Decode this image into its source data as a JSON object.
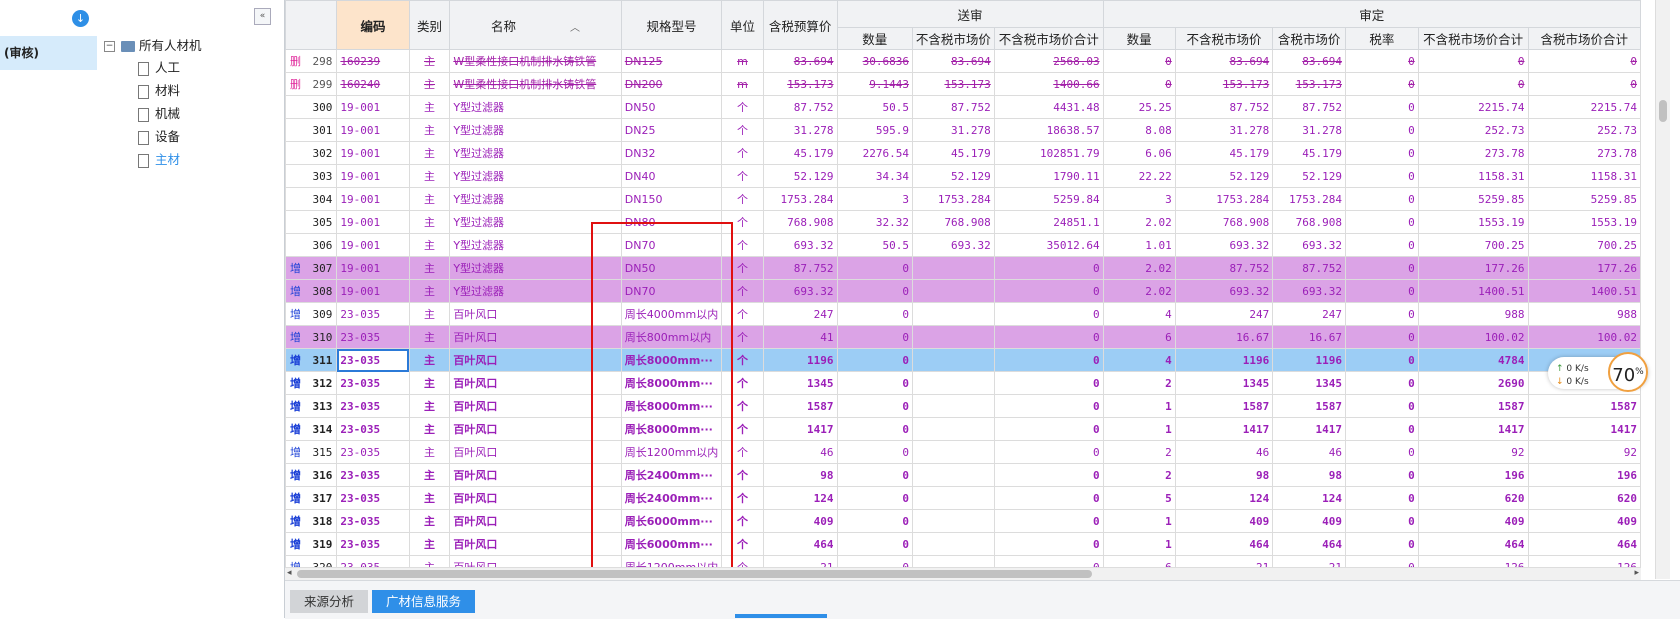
{
  "left_nav": {
    "audit_label": "(审核)"
  },
  "tree": {
    "root": "所有人材机",
    "children": [
      {
        "label": "人工",
        "active": false
      },
      {
        "label": "材料",
        "active": false
      },
      {
        "label": "机械",
        "active": false
      },
      {
        "label": "设备",
        "active": false
      },
      {
        "label": "主材",
        "active": true
      }
    ],
    "collapse_glyph": "«",
    "toggle_glyph": "−"
  },
  "grid": {
    "headers": {
      "code": "编码",
      "cat": "类别",
      "name": "名称",
      "spec": "规格型号",
      "unit": "单位",
      "budget": "含税预算价",
      "group_send": "送审",
      "group_audit": "审定",
      "s_qty": "数量",
      "s_price": "不含税市场价",
      "s_total": "不含税市场价合计",
      "a_qty": "数量",
      "a_price": "不含税市场价",
      "a_price_tax": "含税市场价",
      "a_rate": "税率",
      "a_total": "不含税市场价合计",
      "a_total_tax": "含税市场价合计"
    },
    "rows": [
      {
        "flag": "删",
        "n": "298",
        "code": "160239",
        "cat": "主",
        "name": "W型柔性接口机制排水铸铁管",
        "spec": "DN125",
        "unit": "m",
        "budget": "83.694",
        "sq": "30.6836",
        "sp": "83.694",
        "st": "2568.03",
        "aq": "0",
        "ap": "83.694",
        "apt": "83.694",
        "ar": "0",
        "at": "0",
        "att": "0",
        "style": "del"
      },
      {
        "flag": "删",
        "n": "299",
        "code": "160240",
        "cat": "主",
        "name": "W型柔性接口机制排水铸铁管",
        "spec": "DN200",
        "unit": "m",
        "budget": "153.173",
        "sq": "9.1443",
        "sp": "153.173",
        "st": "1400.66",
        "aq": "0",
        "ap": "153.173",
        "apt": "153.173",
        "ar": "0",
        "at": "0",
        "att": "0",
        "style": "del"
      },
      {
        "flag": "",
        "n": "300",
        "code": "19-001",
        "cat": "主",
        "name": "Y型过滤器",
        "spec": "DN50",
        "unit": "个",
        "budget": "87.752",
        "sq": "50.5",
        "sp": "87.752",
        "st": "4431.48",
        "aq": "25.25",
        "ap": "87.752",
        "apt": "87.752",
        "ar": "0",
        "at": "2215.74",
        "att": "2215.74",
        "style": ""
      },
      {
        "flag": "",
        "n": "301",
        "code": "19-001",
        "cat": "主",
        "name": "Y型过滤器",
        "spec": "DN25",
        "unit": "个",
        "budget": "31.278",
        "sq": "595.9",
        "sp": "31.278",
        "st": "18638.57",
        "aq": "8.08",
        "ap": "31.278",
        "apt": "31.278",
        "ar": "0",
        "at": "252.73",
        "att": "252.73",
        "style": ""
      },
      {
        "flag": "",
        "n": "302",
        "code": "19-001",
        "cat": "主",
        "name": "Y型过滤器",
        "spec": "DN32",
        "unit": "个",
        "budget": "45.179",
        "sq": "2276.54",
        "sp": "45.179",
        "st": "102851.79",
        "aq": "6.06",
        "ap": "45.179",
        "apt": "45.179",
        "ar": "0",
        "at": "273.78",
        "att": "273.78",
        "style": ""
      },
      {
        "flag": "",
        "n": "303",
        "code": "19-001",
        "cat": "主",
        "name": "Y型过滤器",
        "spec": "DN40",
        "unit": "个",
        "budget": "52.129",
        "sq": "34.34",
        "sp": "52.129",
        "st": "1790.11",
        "aq": "22.22",
        "ap": "52.129",
        "apt": "52.129",
        "ar": "0",
        "at": "1158.31",
        "att": "1158.31",
        "style": ""
      },
      {
        "flag": "",
        "n": "304",
        "code": "19-001",
        "cat": "主",
        "name": "Y型过滤器",
        "spec": "DN150",
        "unit": "个",
        "budget": "1753.284",
        "sq": "3",
        "sp": "1753.284",
        "st": "5259.84",
        "aq": "3",
        "ap": "1753.284",
        "apt": "1753.284",
        "ar": "0",
        "at": "5259.85",
        "att": "5259.85",
        "style": ""
      },
      {
        "flag": "",
        "n": "305",
        "code": "19-001",
        "cat": "主",
        "name": "Y型过滤器",
        "spec": "DN80",
        "unit": "个",
        "budget": "768.908",
        "sq": "32.32",
        "sp": "768.908",
        "st": "24851.1",
        "aq": "2.02",
        "ap": "768.908",
        "apt": "768.908",
        "ar": "0",
        "at": "1553.19",
        "att": "1553.19",
        "style": ""
      },
      {
        "flag": "",
        "n": "306",
        "code": "19-001",
        "cat": "主",
        "name": "Y型过滤器",
        "spec": "DN70",
        "unit": "个",
        "budget": "693.32",
        "sq": "50.5",
        "sp": "693.32",
        "st": "35012.64",
        "aq": "1.01",
        "ap": "693.32",
        "apt": "693.32",
        "ar": "0",
        "at": "700.25",
        "att": "700.25",
        "style": ""
      },
      {
        "flag": "增",
        "n": "307",
        "code": "19-001",
        "cat": "主",
        "name": "Y型过滤器",
        "spec": "DN50",
        "unit": "个",
        "budget": "87.752",
        "sq": "0",
        "sp": "",
        "st": "0",
        "aq": "2.02",
        "ap": "87.752",
        "apt": "87.752",
        "ar": "0",
        "at": "177.26",
        "att": "177.26",
        "style": "add hl"
      },
      {
        "flag": "增",
        "n": "308",
        "code": "19-001",
        "cat": "主",
        "name": "Y型过滤器",
        "spec": "DN70",
        "unit": "个",
        "budget": "693.32",
        "sq": "0",
        "sp": "",
        "st": "0",
        "aq": "2.02",
        "ap": "693.32",
        "apt": "693.32",
        "ar": "0",
        "at": "1400.51",
        "att": "1400.51",
        "style": "add hl"
      },
      {
        "flag": "增",
        "n": "309",
        "code": "23-035",
        "cat": "主",
        "name": "百叶风口",
        "spec": "周长4000mm以内",
        "unit": "个",
        "budget": "247",
        "sq": "0",
        "sp": "",
        "st": "0",
        "aq": "4",
        "ap": "247",
        "apt": "247",
        "ar": "0",
        "at": "988",
        "att": "988",
        "style": "add"
      },
      {
        "flag": "增",
        "n": "310",
        "code": "23-035",
        "cat": "主",
        "name": "百叶风口",
        "spec": "周长800mm以内",
        "unit": "个",
        "budget": "41",
        "sq": "0",
        "sp": "",
        "st": "0",
        "aq": "6",
        "ap": "16.67",
        "apt": "16.67",
        "ar": "0",
        "at": "100.02",
        "att": "100.02",
        "style": "add hl"
      },
      {
        "flag": "增",
        "n": "311",
        "code": "23-035",
        "cat": "主",
        "name": "百叶风口",
        "spec": "周长8000mm···",
        "unit": "个",
        "budget": "1196",
        "sq": "0",
        "sp": "",
        "st": "0",
        "aq": "4",
        "ap": "1196",
        "apt": "1196",
        "ar": "0",
        "at": "4784",
        "att": "",
        "style": "add sel bold"
      },
      {
        "flag": "增",
        "n": "312",
        "code": "23-035",
        "cat": "主",
        "name": "百叶风口",
        "spec": "周长8000mm···",
        "unit": "个",
        "budget": "1345",
        "sq": "0",
        "sp": "",
        "st": "0",
        "aq": "2",
        "ap": "1345",
        "apt": "1345",
        "ar": "0",
        "at": "2690",
        "att": "",
        "style": "add bold"
      },
      {
        "flag": "增",
        "n": "313",
        "code": "23-035",
        "cat": "主",
        "name": "百叶风口",
        "spec": "周长8000mm···",
        "unit": "个",
        "budget": "1587",
        "sq": "0",
        "sp": "",
        "st": "0",
        "aq": "1",
        "ap": "1587",
        "apt": "1587",
        "ar": "0",
        "at": "1587",
        "att": "1587",
        "style": "add bold"
      },
      {
        "flag": "增",
        "n": "314",
        "code": "23-035",
        "cat": "主",
        "name": "百叶风口",
        "spec": "周长8000mm···",
        "unit": "个",
        "budget": "1417",
        "sq": "0",
        "sp": "",
        "st": "0",
        "aq": "1",
        "ap": "1417",
        "apt": "1417",
        "ar": "0",
        "at": "1417",
        "att": "1417",
        "style": "add bold"
      },
      {
        "flag": "增",
        "n": "315",
        "code": "23-035",
        "cat": "主",
        "name": "百叶风口",
        "spec": "周长1200mm以内",
        "unit": "个",
        "budget": "46",
        "sq": "0",
        "sp": "",
        "st": "0",
        "aq": "2",
        "ap": "46",
        "apt": "46",
        "ar": "0",
        "at": "92",
        "att": "92",
        "style": "add"
      },
      {
        "flag": "增",
        "n": "316",
        "code": "23-035",
        "cat": "主",
        "name": "百叶风口",
        "spec": "周长2400mm···",
        "unit": "个",
        "budget": "98",
        "sq": "0",
        "sp": "",
        "st": "0",
        "aq": "2",
        "ap": "98",
        "apt": "98",
        "ar": "0",
        "at": "196",
        "att": "196",
        "style": "add bold"
      },
      {
        "flag": "增",
        "n": "317",
        "code": "23-035",
        "cat": "主",
        "name": "百叶风口",
        "spec": "周长2400mm···",
        "unit": "个",
        "budget": "124",
        "sq": "0",
        "sp": "",
        "st": "0",
        "aq": "5",
        "ap": "124",
        "apt": "124",
        "ar": "0",
        "at": "620",
        "att": "620",
        "style": "add bold"
      },
      {
        "flag": "增",
        "n": "318",
        "code": "23-035",
        "cat": "主",
        "name": "百叶风口",
        "spec": "周长6000mm···",
        "unit": "个",
        "budget": "409",
        "sq": "0",
        "sp": "",
        "st": "0",
        "aq": "1",
        "ap": "409",
        "apt": "409",
        "ar": "0",
        "at": "409",
        "att": "409",
        "style": "add bold"
      },
      {
        "flag": "增",
        "n": "319",
        "code": "23-035",
        "cat": "主",
        "name": "百叶风口",
        "spec": "周长6000mm···",
        "unit": "个",
        "budget": "464",
        "sq": "0",
        "sp": "",
        "st": "0",
        "aq": "1",
        "ap": "464",
        "apt": "464",
        "ar": "0",
        "at": "464",
        "att": "464",
        "style": "add bold"
      },
      {
        "flag": "增",
        "n": "320",
        "code": "23-035",
        "cat": "主",
        "name": "百叶风口",
        "spec": "周长1200mm以内",
        "unit": "个",
        "budget": "21",
        "sq": "0",
        "sp": "",
        "st": "0",
        "aq": "6",
        "ap": "21",
        "apt": "21",
        "ar": "0",
        "at": "126",
        "att": "126",
        "style": "add"
      }
    ]
  },
  "tabs": {
    "source": "来源分析",
    "guangcai": "广材信息服务"
  },
  "speed_widget": {
    "up": "0  K/s",
    "down": "0  K/s",
    "percent": "70",
    "percent_unit": "%"
  },
  "scroll": {
    "left": "◂",
    "right": "▸"
  },
  "colors": {
    "accent": "#2f8fe8",
    "highlight_row": "#dba3e6",
    "selected_row": "#9ccdf5",
    "text_purple": "#9b1fb8",
    "red_box": "#e01010"
  }
}
